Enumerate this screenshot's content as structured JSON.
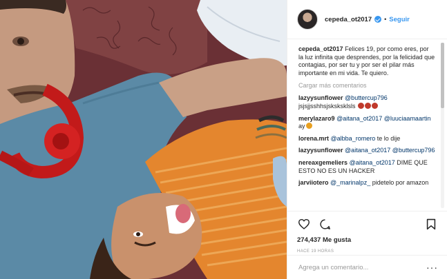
{
  "post": {
    "username": "cepeda_ot2017",
    "follow_label": "Seguir",
    "separator": "•",
    "caption": "Felices 19, por como eres, por la luz infinita que desprendes, por la felicidad que contagias, por ser tu y por ser el pilar más importante en mi vida. Te quiero.",
    "load_more": "Cargar más comentarios",
    "likes": "274,437 Me gusta",
    "timestamp": "HACE 19 HORAS",
    "add_comment_placeholder": "Agrega un comentario..."
  },
  "comments": [
    {
      "user": "lazyysunflower",
      "mention": "@buttercup796",
      "text": "jsjsjjsshhsjsksksklsls",
      "emoji": [
        "chili-red",
        "chili-red",
        "chili-red"
      ]
    },
    {
      "user": "merylazaro9",
      "mention": "@aitana_ot2017",
      "mention2": "@luuciaamaartin",
      "text": "ay",
      "emoji": [
        "grin-face"
      ]
    },
    {
      "user": "lorena.mrt",
      "mention": "@albba_romero",
      "text": "te lo dije"
    },
    {
      "user": "lazyysunflower",
      "mention": "@aitana_ot2017",
      "mention2": "@buttercup796",
      "text": ""
    },
    {
      "user": "nereaxgemeliers",
      "mention": "@aitana_ot2017",
      "text": "DIME QUE ESTO NO ES UN HACKER"
    },
    {
      "user": "jarviiotero",
      "mention": "@_marinalpz_",
      "text": "pidetelo por amazon"
    }
  ],
  "icons": {
    "like": "heart-icon",
    "comment": "comment-icon",
    "save": "bookmark-icon",
    "more": "more-options-icon"
  },
  "colors": {
    "link_blue": "#3897f0",
    "mention": "#003569",
    "muted": "#999999",
    "text": "#262626"
  }
}
